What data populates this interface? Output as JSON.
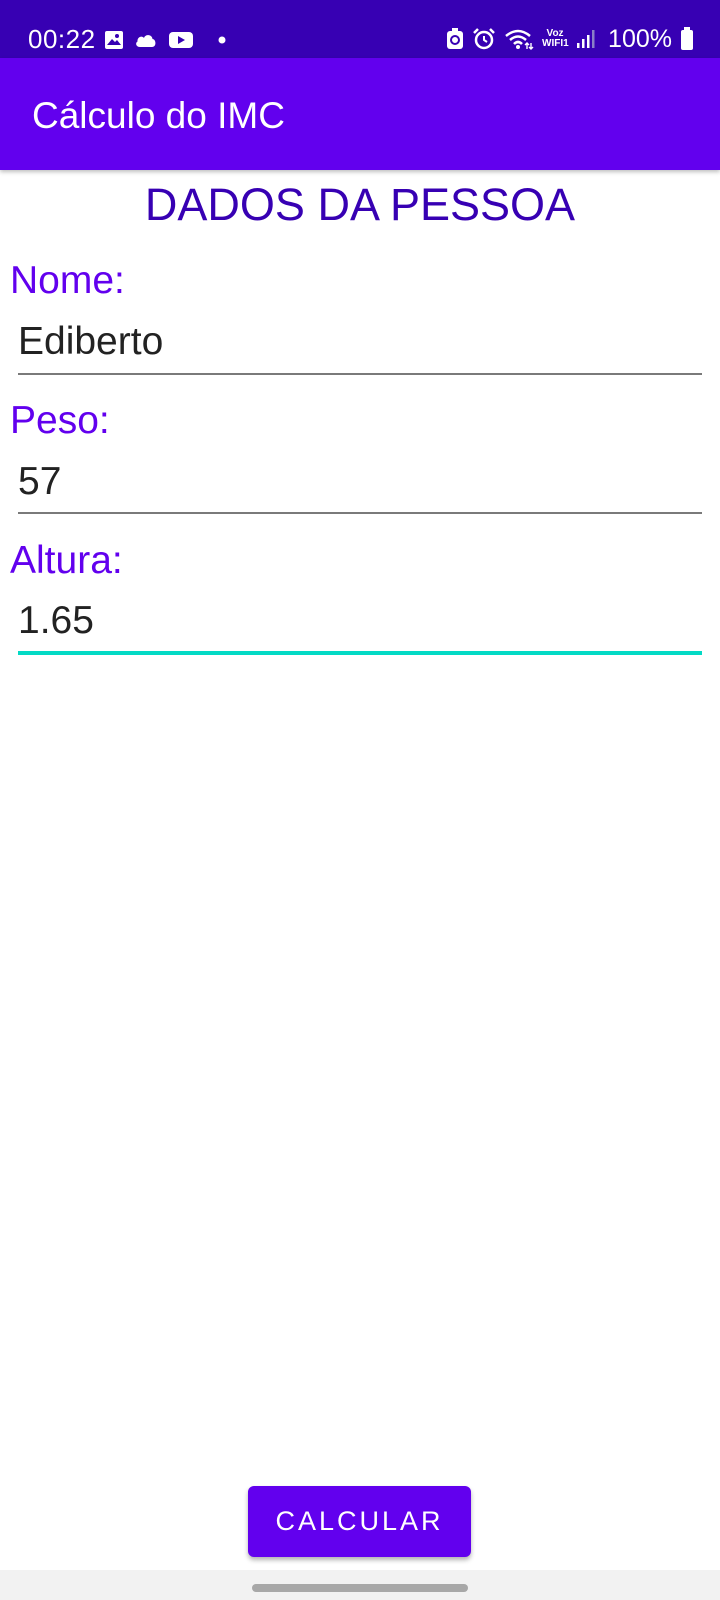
{
  "status_bar": {
    "time": "00:22",
    "left_icons": [
      "gallery-icon",
      "cloud-icon",
      "youtube-icon",
      "dot-icon"
    ],
    "right_icons": [
      "recycle-icon",
      "alarm-icon",
      "wifi-icon",
      "vowifi-icon",
      "signal-icon",
      "battery-icon"
    ],
    "vowifi_top": "Voz",
    "vowifi_bottom": "WIFI1",
    "battery": "100%"
  },
  "app_bar": {
    "title": "Cálculo do IMC"
  },
  "form": {
    "heading": "DADOS DA PESSOA",
    "fields": [
      {
        "label": "Nome:",
        "value": "Ediberto"
      },
      {
        "label": "Peso:",
        "value": "57"
      },
      {
        "label": "Altura:",
        "value": "1.65",
        "focused": true
      }
    ]
  },
  "actions": {
    "calculate_label": "CALCULAR"
  },
  "colors": {
    "primary": "#6200EE",
    "primary_dark": "#3700B3",
    "accent": "#03DAC5"
  }
}
